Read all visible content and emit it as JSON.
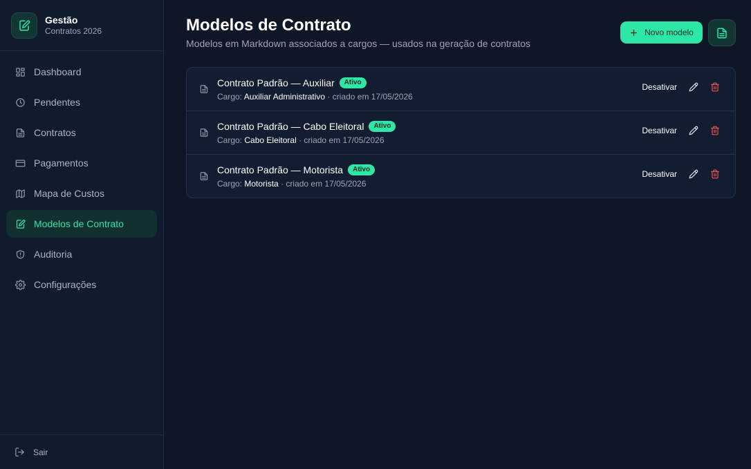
{
  "brand": {
    "name": "Gestão",
    "subtitle": "Contratos 2026"
  },
  "sidebar": {
    "items": [
      {
        "label": "Dashboard",
        "icon": "dashboard-icon"
      },
      {
        "label": "Pendentes",
        "icon": "clock-icon"
      },
      {
        "label": "Contratos",
        "icon": "file-text-icon"
      },
      {
        "label": "Pagamentos",
        "icon": "credit-card-icon"
      },
      {
        "label": "Mapa de Custos",
        "icon": "map-icon"
      },
      {
        "label": "Modelos de Contrato",
        "icon": "file-edit-icon",
        "active": true
      },
      {
        "label": "Auditoria",
        "icon": "shield-icon"
      },
      {
        "label": "Configurações",
        "icon": "gear-icon"
      }
    ],
    "logout_label": "Sair"
  },
  "header": {
    "title": "Modelos de Contrato",
    "subtitle": "Modelos em Markdown associados a cargos — usados na geração de contratos",
    "new_button_label": "Novo modelo"
  },
  "models": [
    {
      "title": "Contrato Padrão — Auxiliar",
      "badge": "Ativo",
      "cargo_label": "Cargo:",
      "cargo": "Auxiliar Administrativo",
      "created": "· criado em 17/05/2026",
      "deactivate_label": "Desativar"
    },
    {
      "title": "Contrato Padrão — Cabo Eleitoral",
      "badge": "Ativo",
      "cargo_label": "Cargo:",
      "cargo": "Cabo Eleitoral",
      "created": "· criado em 17/05/2026",
      "deactivate_label": "Desativar"
    },
    {
      "title": "Contrato Padrão — Motorista",
      "badge": "Ativo",
      "cargo_label": "Cargo:",
      "cargo": "Motorista",
      "created": "· criado em 17/05/2026",
      "deactivate_label": "Desativar"
    }
  ],
  "colors": {
    "accent": "#2ee6a6",
    "background": "#0f1626",
    "sidebar": "#111b2e",
    "danger": "#f05454"
  }
}
